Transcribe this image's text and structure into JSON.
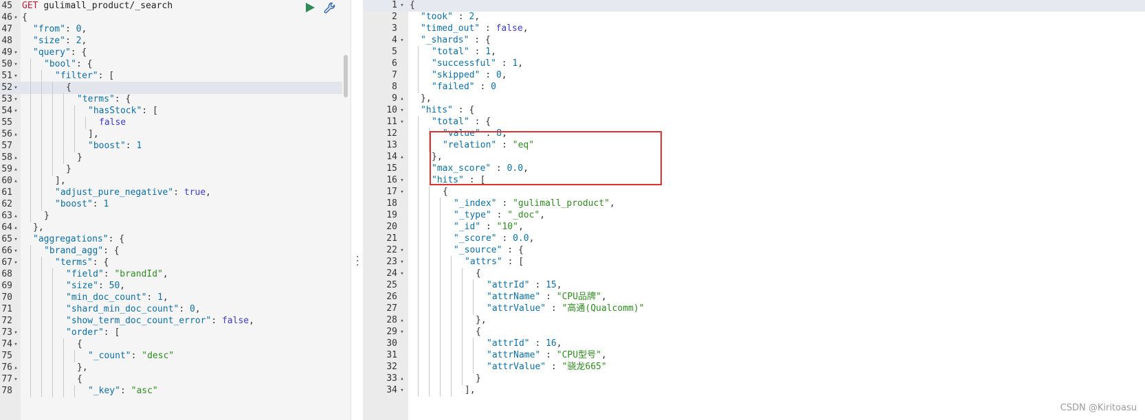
{
  "request": {
    "method": "GET",
    "url": "gulimall_product/_search"
  },
  "left_lines": [
    {
      "n": "45",
      "fold": "",
      "indent": 0,
      "html": "REQUEST"
    },
    {
      "n": "46",
      "fold": "▾",
      "indent": 0,
      "text": "{"
    },
    {
      "n": "47",
      "fold": "",
      "indent": 1,
      "text": "\"from\": 0,"
    },
    {
      "n": "48",
      "fold": "",
      "indent": 1,
      "text": "\"size\": 2,"
    },
    {
      "n": "49",
      "fold": "▾",
      "indent": 1,
      "text": "\"query\": {"
    },
    {
      "n": "50",
      "fold": "▾",
      "indent": 2,
      "text": "\"bool\": {"
    },
    {
      "n": "51",
      "fold": "▾",
      "indent": 3,
      "text": "\"filter\": ["
    },
    {
      "n": "52",
      "fold": "▾",
      "indent": 4,
      "text": "{"
    },
    {
      "n": "53",
      "fold": "▾",
      "indent": 5,
      "text": "\"terms\": {"
    },
    {
      "n": "54",
      "fold": "▾",
      "indent": 6,
      "text": "\"hasStock\": ["
    },
    {
      "n": "55",
      "fold": "",
      "indent": 7,
      "text": "false"
    },
    {
      "n": "56",
      "fold": "▴",
      "indent": 6,
      "text": "],"
    },
    {
      "n": "57",
      "fold": "",
      "indent": 6,
      "text": "\"boost\": 1"
    },
    {
      "n": "58",
      "fold": "▴",
      "indent": 5,
      "text": "}"
    },
    {
      "n": "59",
      "fold": "▴",
      "indent": 4,
      "text": "}"
    },
    {
      "n": "60",
      "fold": "▴",
      "indent": 3,
      "text": "],"
    },
    {
      "n": "61",
      "fold": "",
      "indent": 3,
      "text": "\"adjust_pure_negative\": true,"
    },
    {
      "n": "62",
      "fold": "",
      "indent": 3,
      "text": "\"boost\": 1"
    },
    {
      "n": "63",
      "fold": "▴",
      "indent": 2,
      "text": "}"
    },
    {
      "n": "64",
      "fold": "▴",
      "indent": 1,
      "text": "},"
    },
    {
      "n": "65",
      "fold": "▾",
      "indent": 1,
      "text": "\"aggregations\": {"
    },
    {
      "n": "66",
      "fold": "▾",
      "indent": 2,
      "text": "\"brand_agg\": {"
    },
    {
      "n": "67",
      "fold": "▾",
      "indent": 3,
      "text": "\"terms\": {"
    },
    {
      "n": "68",
      "fold": "",
      "indent": 4,
      "text": "\"field\": \"brandId\","
    },
    {
      "n": "69",
      "fold": "",
      "indent": 4,
      "text": "\"size\": 50,"
    },
    {
      "n": "70",
      "fold": "",
      "indent": 4,
      "text": "\"min_doc_count\": 1,"
    },
    {
      "n": "71",
      "fold": "",
      "indent": 4,
      "text": "\"shard_min_doc_count\": 0,"
    },
    {
      "n": "72",
      "fold": "",
      "indent": 4,
      "text": "\"show_term_doc_count_error\": false,"
    },
    {
      "n": "73",
      "fold": "▾",
      "indent": 4,
      "text": "\"order\": ["
    },
    {
      "n": "74",
      "fold": "▾",
      "indent": 5,
      "text": "{"
    },
    {
      "n": "75",
      "fold": "",
      "indent": 6,
      "text": "\"_count\": \"desc\""
    },
    {
      "n": "76",
      "fold": "▴",
      "indent": 5,
      "text": "},"
    },
    {
      "n": "77",
      "fold": "▾",
      "indent": 5,
      "text": "{"
    },
    {
      "n": "78",
      "fold": "",
      "indent": 6,
      "text": "\"_key\": \"asc\""
    }
  ],
  "right_lines": [
    {
      "n": "1",
      "fold": "▾",
      "indent": 0,
      "text": "{"
    },
    {
      "n": "2",
      "fold": "",
      "indent": 1,
      "text": "\"took\" : 2,"
    },
    {
      "n": "3",
      "fold": "",
      "indent": 1,
      "text": "\"timed_out\" : false,"
    },
    {
      "n": "4",
      "fold": "▾",
      "indent": 1,
      "text": "\"_shards\" : {"
    },
    {
      "n": "5",
      "fold": "",
      "indent": 2,
      "text": "\"total\" : 1,"
    },
    {
      "n": "6",
      "fold": "",
      "indent": 2,
      "text": "\"successful\" : 1,"
    },
    {
      "n": "7",
      "fold": "",
      "indent": 2,
      "text": "\"skipped\" : 0,"
    },
    {
      "n": "8",
      "fold": "",
      "indent": 2,
      "text": "\"failed\" : 0"
    },
    {
      "n": "9",
      "fold": "▴",
      "indent": 1,
      "text": "},"
    },
    {
      "n": "10",
      "fold": "▾",
      "indent": 1,
      "text": "\"hits\" : {"
    },
    {
      "n": "11",
      "fold": "▾",
      "indent": 2,
      "text": "\"total\" : {"
    },
    {
      "n": "12",
      "fold": "",
      "indent": 3,
      "text": "\"value\" : 8,"
    },
    {
      "n": "13",
      "fold": "",
      "indent": 3,
      "text": "\"relation\" : \"eq\""
    },
    {
      "n": "14",
      "fold": "▴",
      "indent": 2,
      "text": "},"
    },
    {
      "n": "15",
      "fold": "",
      "indent": 2,
      "text": "\"max_score\" : 0.0,"
    },
    {
      "n": "16",
      "fold": "▾",
      "indent": 2,
      "text": "\"hits\" : ["
    },
    {
      "n": "17",
      "fold": "▾",
      "indent": 3,
      "text": "{"
    },
    {
      "n": "18",
      "fold": "",
      "indent": 4,
      "text": "\"_index\" : \"gulimall_product\","
    },
    {
      "n": "19",
      "fold": "",
      "indent": 4,
      "text": "\"_type\" : \"_doc\","
    },
    {
      "n": "20",
      "fold": "",
      "indent": 4,
      "text": "\"_id\" : \"10\","
    },
    {
      "n": "21",
      "fold": "",
      "indent": 4,
      "text": "\"_score\" : 0.0,"
    },
    {
      "n": "22",
      "fold": "▾",
      "indent": 4,
      "text": "\"_source\" : {"
    },
    {
      "n": "23",
      "fold": "▾",
      "indent": 5,
      "text": "\"attrs\" : ["
    },
    {
      "n": "24",
      "fold": "▾",
      "indent": 6,
      "text": "{"
    },
    {
      "n": "25",
      "fold": "",
      "indent": 7,
      "text": "\"attrId\" : 15,"
    },
    {
      "n": "26",
      "fold": "",
      "indent": 7,
      "text": "\"attrName\" : \"CPU品牌\","
    },
    {
      "n": "27",
      "fold": "",
      "indent": 7,
      "text": "\"attrValue\" : \"高通(Qualcomm)\""
    },
    {
      "n": "28",
      "fold": "▴",
      "indent": 6,
      "text": "},"
    },
    {
      "n": "29",
      "fold": "▾",
      "indent": 6,
      "text": "{"
    },
    {
      "n": "30",
      "fold": "",
      "indent": 7,
      "text": "\"attrId\" : 16,"
    },
    {
      "n": "31",
      "fold": "",
      "indent": 7,
      "text": "\"attrName\" : \"CPU型号\","
    },
    {
      "n": "32",
      "fold": "",
      "indent": 7,
      "text": "\"attrValue\" : \"骁龙665\""
    },
    {
      "n": "33",
      "fold": "▴",
      "indent": 6,
      "text": "}"
    },
    {
      "n": "34",
      "fold": "▾",
      "indent": 5,
      "text": "],"
    }
  ],
  "active_left_line": "52",
  "active_right_line": "1",
  "watermark": "CSDN @Kiritoasu",
  "colors": {
    "play": "#2e8b57",
    "wrench": "#3a6fb0",
    "highlight": "#e03131"
  }
}
